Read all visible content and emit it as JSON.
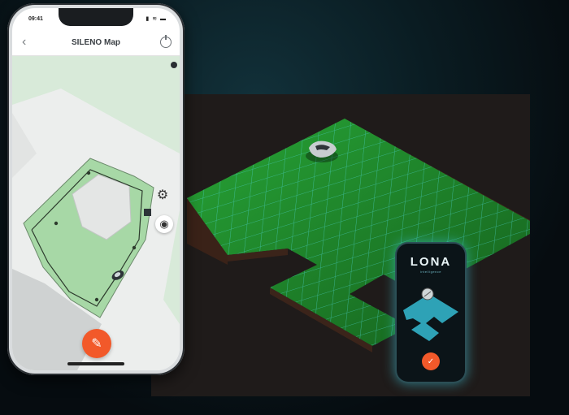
{
  "phone": {
    "time": "09:41",
    "status_icons": "▮ ≋ ▬",
    "title": "SILENO Map",
    "back_icon": "chevron-left-icon",
    "power_icon": "power-icon",
    "gear_icon": "gear-icon",
    "eye_icon": "eye-icon",
    "edit_icon": "pencil-icon",
    "accent_color": "#f2592a",
    "lawn_color": "#a7d8a6"
  },
  "lona_phone": {
    "logo": "LONA",
    "subtitle": "intelligence",
    "confirm_icon": "check-icon",
    "map_color": "#2fa0b4"
  },
  "scene": {
    "grass_color": "#1f8a2b",
    "grid_color": "#40d4d8",
    "robot_icon": "robot-mower-icon"
  }
}
